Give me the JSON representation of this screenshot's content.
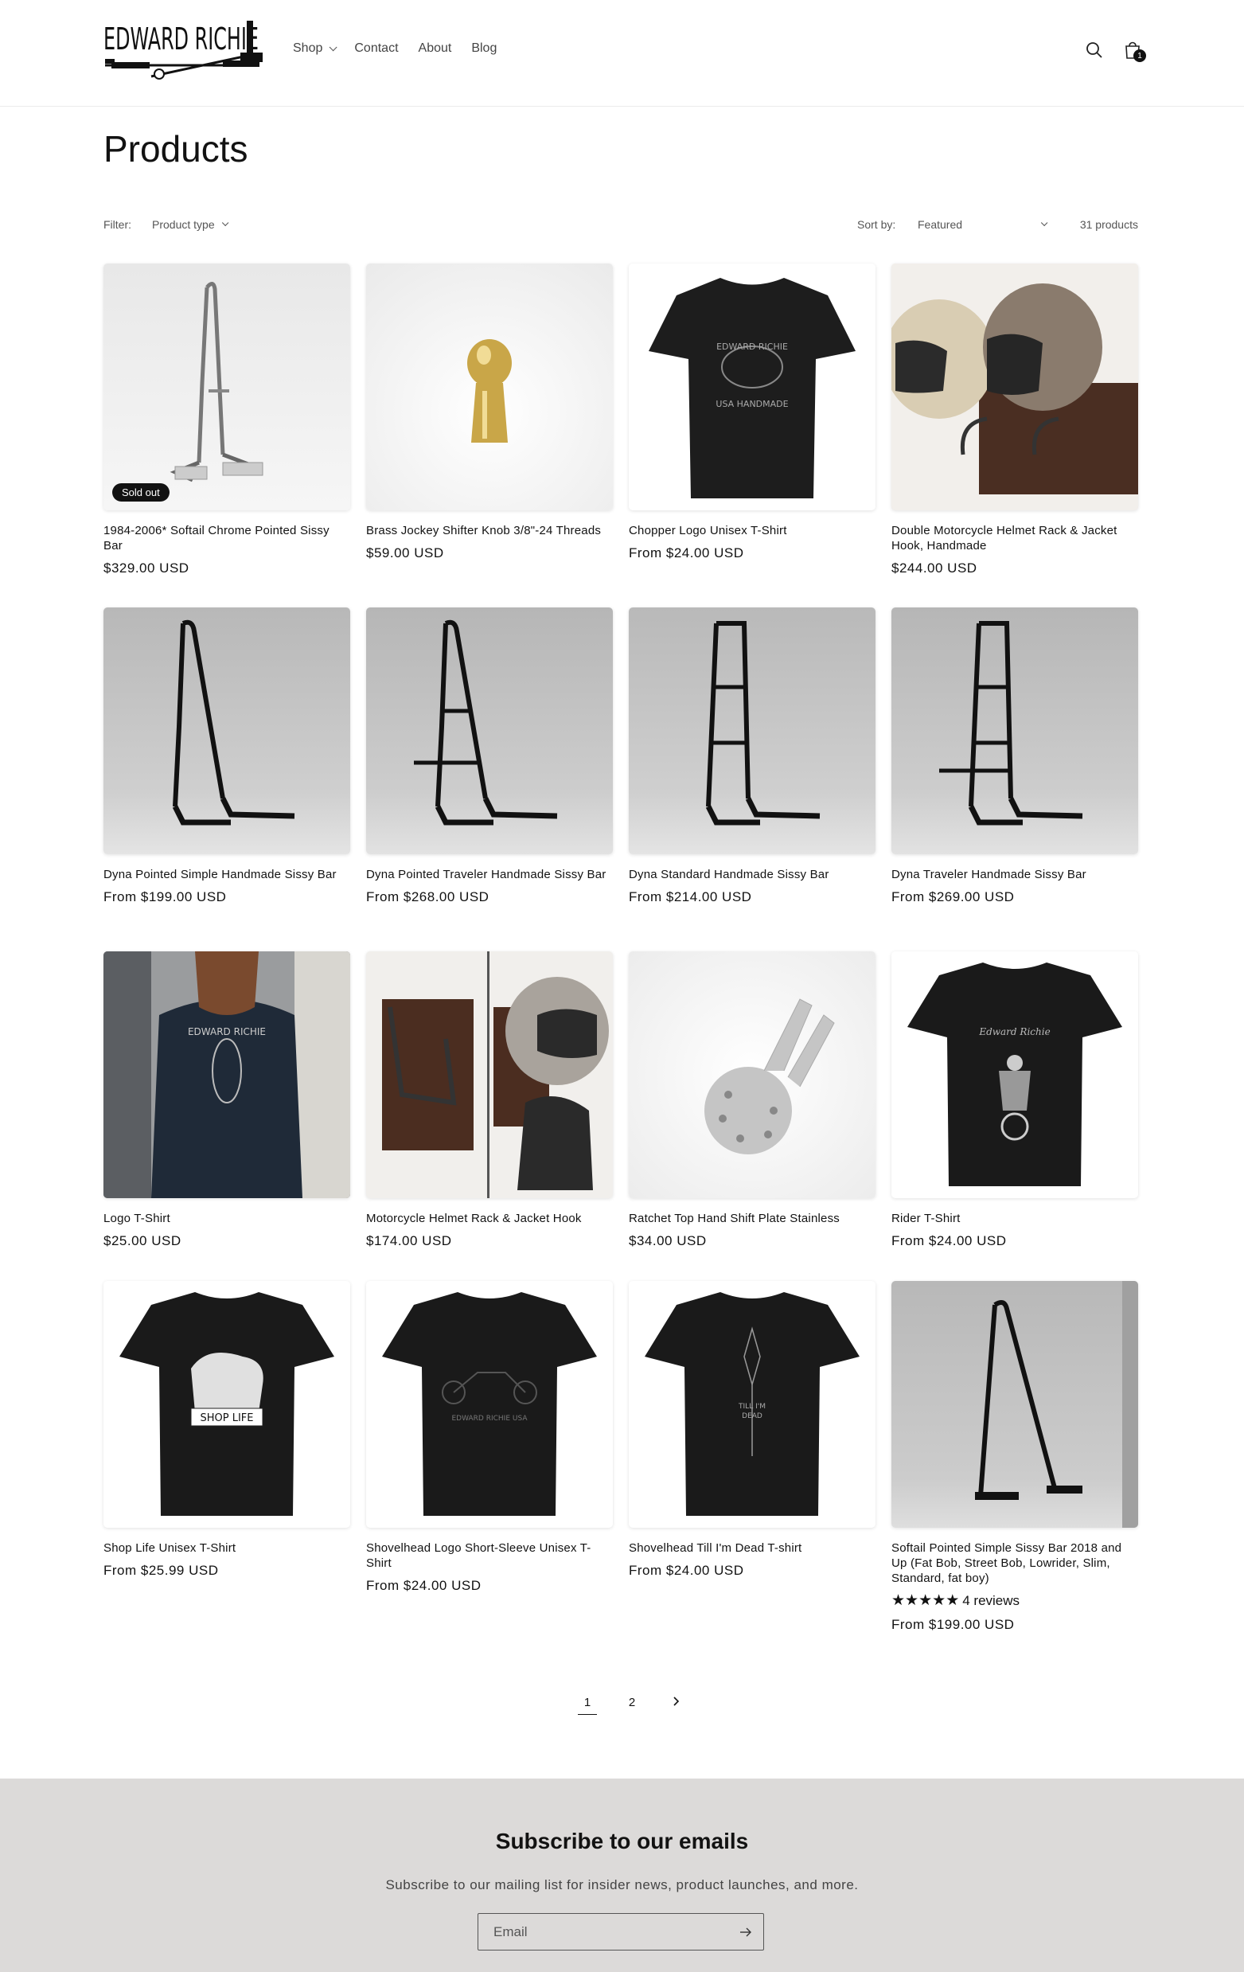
{
  "header": {
    "brand": "EDWARD RICHIE",
    "nav": [
      {
        "label": "Shop",
        "dropdown": true
      },
      {
        "label": "Contact",
        "dropdown": false
      },
      {
        "label": "About",
        "dropdown": false
      },
      {
        "label": "Blog",
        "dropdown": false
      }
    ],
    "cart_count": "1"
  },
  "page_title": "Products",
  "filter": {
    "label": "Filter:",
    "product_type": "Product type",
    "sort_label": "Sort by:",
    "sort_value": "Featured",
    "count": "31 products"
  },
  "products": [
    {
      "title": "1984-2006* Softail Chrome Pointed Sissy Bar",
      "price": "$329.00 USD",
      "badge": "Sold out",
      "image": "chrome-sissy-bar"
    },
    {
      "title": "Brass Jockey Shifter Knob 3/8\"-24 Threads",
      "price": "$59.00 USD",
      "image": "brass-knob"
    },
    {
      "title": "Chopper Logo Unisex T-Shirt",
      "price": "From $24.00 USD",
      "image": "tshirt-chopper"
    },
    {
      "title": "Double Motorcycle Helmet Rack & Jacket Hook, Handmade",
      "price": "$244.00 USD",
      "image": "helmet-rack-double"
    },
    {
      "title": "Dyna Pointed Simple Handmade Sissy Bar",
      "price": "From $199.00 USD",
      "image": "sissy-bar-black-1"
    },
    {
      "title": "Dyna Pointed Traveler Handmade Sissy Bar",
      "price": "From $268.00 USD",
      "image": "sissy-bar-black-2"
    },
    {
      "title": "Dyna Standard Handmade Sissy Bar",
      "price": "From $214.00 USD",
      "image": "sissy-bar-black-3"
    },
    {
      "title": "Dyna Traveler Handmade Sissy Bar",
      "price": "From $269.00 USD",
      "image": "sissy-bar-black-4"
    },
    {
      "title": "Logo T-Shirt",
      "price": "$25.00 USD",
      "image": "man-tshirt"
    },
    {
      "title": "Motorcycle Helmet Rack & Jacket Hook",
      "price": "$174.00 USD",
      "image": "helmet-rack-single"
    },
    {
      "title": "Ratchet Top Hand Shift Plate Stainless",
      "price": "$34.00 USD",
      "image": "shift-plate"
    },
    {
      "title": "Rider T-Shirt",
      "price": "From $24.00 USD",
      "image": "tshirt-rider"
    },
    {
      "title": "Shop Life Unisex T-Shirt",
      "price": "From $25.99 USD",
      "image": "tshirt-shoplife"
    },
    {
      "title": "Shovelhead Logo Short-Sleeve Unisex T-Shirt",
      "price": "From $24.00 USD",
      "image": "tshirt-shovelhead"
    },
    {
      "title": "Shovelhead Till I'm Dead T-shirt",
      "price": "From $24.00 USD",
      "image": "tshirt-till-dead"
    },
    {
      "title": "Softail Pointed Simple Sissy Bar 2018 and Up (Fat Bob, Street Bob, Lowrider, Slim, Standard, fat boy)",
      "price": "From $199.00 USD",
      "rating_stars": 5,
      "reviews": "4 reviews",
      "image": "softail-sissy-bar"
    }
  ],
  "pagination": {
    "pages": [
      "1",
      "2"
    ],
    "current": "1",
    "next_icon": "chevron-right-icon"
  },
  "newsletter": {
    "title": "Subscribe to our emails",
    "subtitle": "Subscribe to our mailing list for insider news, product launches, and more.",
    "placeholder": "Email"
  },
  "colors": {
    "text": "#121212",
    "footer_bg": "#dcdad9",
    "badge_bg": "#121212"
  }
}
